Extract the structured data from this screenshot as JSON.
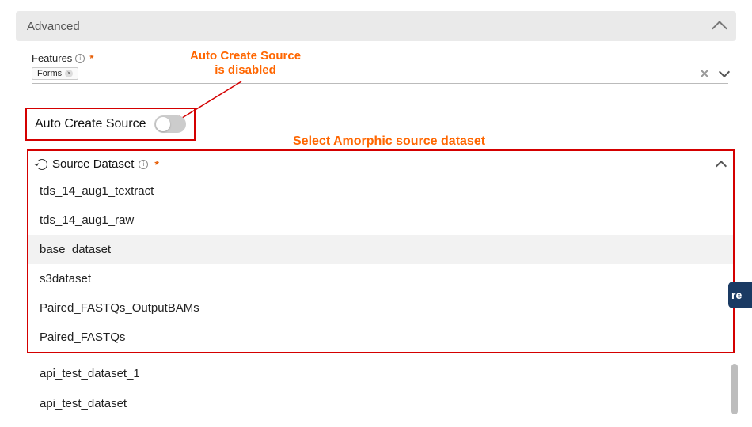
{
  "header": {
    "title": "Advanced"
  },
  "features": {
    "label": "Features",
    "chip": "Forms"
  },
  "autoCreate": {
    "label": "Auto Create Source",
    "enabled": false
  },
  "annotations": {
    "disabled_line1": "Auto Create Source",
    "disabled_line2": "is disabled",
    "select_source": "Select Amorphic source dataset"
  },
  "sourceDataset": {
    "label": "Source Dataset",
    "options_boxed": [
      "tds_14_aug1_textract",
      "tds_14_aug1_raw",
      "base_dataset",
      "s3dataset",
      "Paired_FASTQs_OutputBAMs",
      "Paired_FASTQs"
    ],
    "options_below": [
      "api_test_dataset_1",
      "api_test_dataset"
    ],
    "highlighted_index": 2
  },
  "side_chip": "re"
}
